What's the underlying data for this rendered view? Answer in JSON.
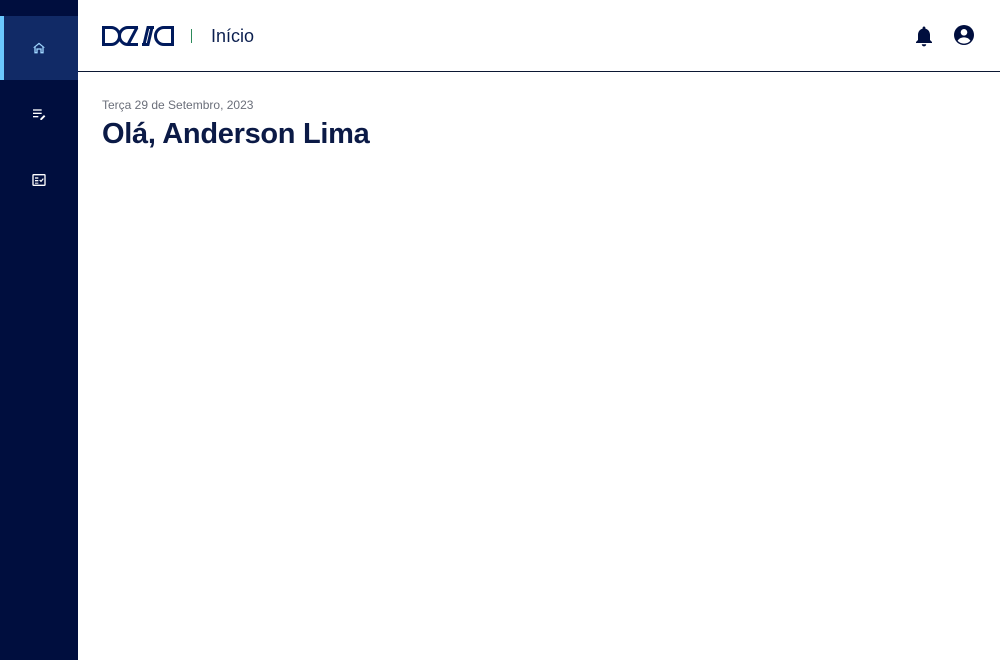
{
  "sidebar": {
    "items": [
      {
        "icon": "home-icon",
        "active": true
      },
      {
        "icon": "edit-list-icon",
        "active": false
      },
      {
        "icon": "checklist-icon",
        "active": false
      }
    ]
  },
  "header": {
    "logo_text": "DASA",
    "page_title": "Início",
    "icons": [
      "bell-icon",
      "account-circle-icon"
    ]
  },
  "main": {
    "date": "Terça 29 de Setembro, 2023",
    "greeting": "Olá, Anderson Lima"
  },
  "colors": {
    "sidebar_bg": "#000e3e",
    "sidebar_active_bg": "#112a66",
    "active_indicator": "#6ac8ff",
    "text_primary": "#0b1a46",
    "text_muted": "#6b6f7a"
  }
}
